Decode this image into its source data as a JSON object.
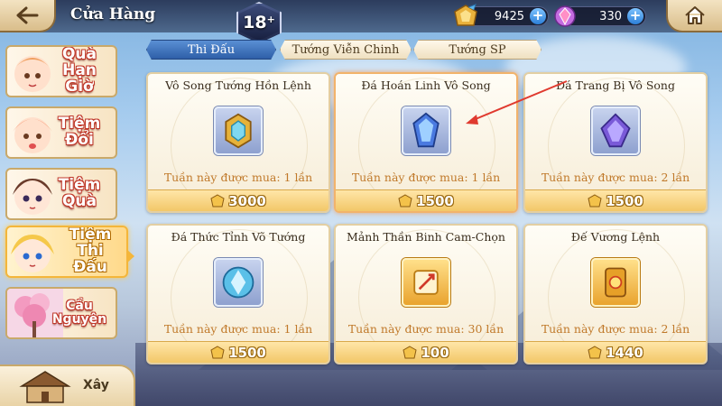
{
  "header": {
    "title": "Cửa Hàng",
    "level": "18",
    "level_suffix": "+",
    "currency_a": "9425",
    "currency_b": "330"
  },
  "sidebar": {
    "items": [
      {
        "label": "Quà Hạn Giờ"
      },
      {
        "label": "Tiệm Đổi"
      },
      {
        "label": "Tiệm Quà"
      },
      {
        "label": "Tiệm Thi Đấu"
      },
      {
        "label": "Cầu Nguyện"
      }
    ],
    "build_label": "Xây"
  },
  "tabs": [
    {
      "label": "Thi Đấu"
    },
    {
      "label": "Tướng Viễn Chinh"
    },
    {
      "label": "Tướng SP"
    }
  ],
  "shop": {
    "items": [
      {
        "name": "Vô Song Tướng Hồn Lệnh",
        "limit": "Tuần này được mua: 1 lần",
        "price": "3000"
      },
      {
        "name": "Đá Hoán Linh Vô Song",
        "limit": "Tuần này được mua: 1 lần",
        "price": "1500"
      },
      {
        "name": "Đá Trang Bị Vô Song",
        "limit": "Tuần này được mua: 2 lần",
        "price": "1500"
      },
      {
        "name": "Đá Thức Tỉnh Võ Tướng",
        "limit": "Tuần này được mua: 1 lần",
        "price": "1500"
      },
      {
        "name": "Mảnh Thần Binh Cam-Chọn",
        "limit": "Tuần này được mua: 30 lần",
        "price": "100"
      },
      {
        "name": "Đế Vương Lệnh",
        "limit": "Tuần này được mua: 2 lần",
        "price": "1440"
      }
    ]
  },
  "colors": {
    "accent_blue": "#2e5fa8",
    "price_gold": "#f2c768",
    "limit_text": "#c0792a",
    "annotation_arrow": "#e03a2f"
  }
}
